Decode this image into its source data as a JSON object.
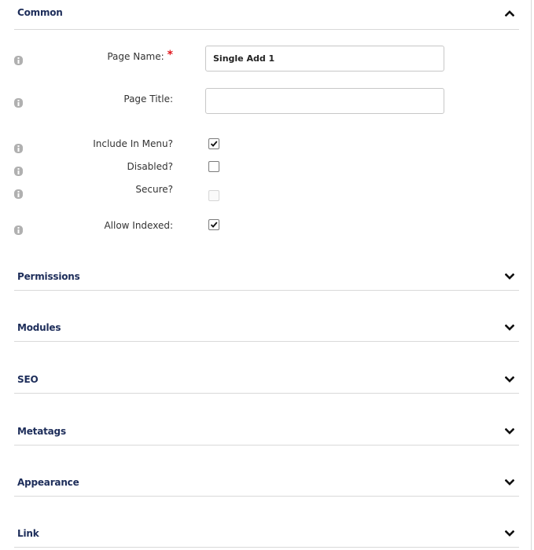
{
  "common": {
    "title": "Common",
    "fields": {
      "page_name": {
        "label": "Page Name:",
        "required_mark": "*",
        "value": "Single Add 1",
        "placeholder": ""
      },
      "page_title": {
        "label": "Page Title:",
        "value": "",
        "placeholder": ""
      },
      "include_in_menu": {
        "label": "Include In Menu?",
        "checked": true
      },
      "disabled": {
        "label": "Disabled?",
        "checked": false
      },
      "secure": {
        "label": "Secure?",
        "checked": false,
        "enabled": false
      },
      "allow_indexed": {
        "label": "Allow Indexed:",
        "checked": true
      }
    }
  },
  "sections": [
    {
      "title": "Permissions"
    },
    {
      "title": "Modules"
    },
    {
      "title": "SEO"
    },
    {
      "title": "Metatags"
    },
    {
      "title": "Appearance"
    },
    {
      "title": "Link"
    }
  ],
  "colors": {
    "section_title": "#1d2d5a",
    "required": "#e0161d",
    "divider": "#d9d9d9"
  },
  "icons": {
    "info": "info-icon",
    "collapse": "chevron-up-icon",
    "expand": "chevron-down-icon"
  }
}
